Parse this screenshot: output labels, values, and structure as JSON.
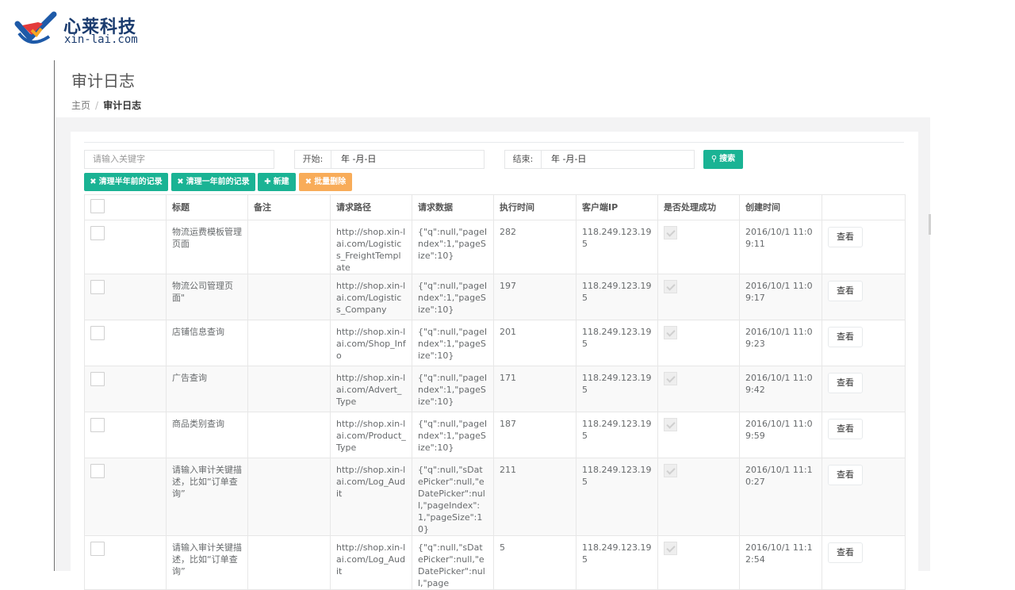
{
  "brand": {
    "name": "心莱科技",
    "domain": "xin-lai.com"
  },
  "page": {
    "title": "审计日志"
  },
  "breadcrumb": {
    "home": "主页",
    "sep": "/",
    "current": "审计日志"
  },
  "filters": {
    "keyword_placeholder": "请输入关键字",
    "start_label": "开始:",
    "start_value": "年 -月-日",
    "end_label": "结束:",
    "end_value": "年 -月-日",
    "search_label": "搜索"
  },
  "actions": {
    "clear_half_year": "清理半年前的记录",
    "clear_one_year": "清理一年前的记录",
    "create": "新建",
    "batch_delete": "批量删除"
  },
  "table": {
    "headers": [
      "",
      "标题",
      "备注",
      "请求路径",
      "请求数据",
      "执行时间",
      "客户端IP",
      "是否处理成功",
      "创建时间",
      ""
    ],
    "view_label": "查看",
    "rows": [
      {
        "title": "物流运费模板管理页面",
        "remark": "",
        "path": "http://shop.xin-lai.com/Logistics_FreightTemplate",
        "data": "{\"q\":null,\"pageIndex\":1,\"pageSize\":10}",
        "exec_time": "282",
        "ip": "118.249.123.195",
        "created": "2016/10/1 11:09:11"
      },
      {
        "title": "物流公司管理页面\"",
        "remark": "",
        "path": "http://shop.xin-lai.com/Logistics_Company",
        "data": "{\"q\":null,\"pageIndex\":1,\"pageSize\":10}",
        "exec_time": "197",
        "ip": "118.249.123.195",
        "created": "2016/10/1 11:09:17"
      },
      {
        "title": "店铺信息查询",
        "remark": "",
        "path": "http://shop.xin-lai.com/Shop_Info",
        "data": "{\"q\":null,\"pageIndex\":1,\"pageSize\":10}",
        "exec_time": "201",
        "ip": "118.249.123.195",
        "created": "2016/10/1 11:09:23"
      },
      {
        "title": "广告查询",
        "remark": "",
        "path": "http://shop.xin-lai.com/Advert_Type",
        "data": "{\"q\":null,\"pageIndex\":1,\"pageSize\":10}",
        "exec_time": "171",
        "ip": "118.249.123.195",
        "created": "2016/10/1 11:09:42"
      },
      {
        "title": "商品类别查询",
        "remark": "",
        "path": "http://shop.xin-lai.com/Product_Type",
        "data": "{\"q\":null,\"pageIndex\":1,\"pageSize\":10}",
        "exec_time": "187",
        "ip": "118.249.123.195",
        "created": "2016/10/1 11:09:59"
      },
      {
        "title": "请输入审计关键描述，比如“订单查询”",
        "remark": "",
        "path": "http://shop.xin-lai.com/Log_Audit",
        "data": "{\"q\":null,\"sDatePicker\":null,\"eDatePicker\":null,\"pageIndex\":1,\"pageSize\":10}",
        "exec_time": "211",
        "ip": "118.249.123.195",
        "created": "2016/10/1 11:10:27"
      },
      {
        "title": "请输入审计关键描述，比如“订单查询”",
        "remark": "",
        "path": "http://shop.xin-lai.com/Log_Audit",
        "data": "{\"q\":null,\"sDatePicker\":null,\"eDatePicker\":null,\"page",
        "exec_time": "5",
        "ip": "118.249.123.195",
        "created": "2016/10/1 11:12:54"
      }
    ]
  }
}
